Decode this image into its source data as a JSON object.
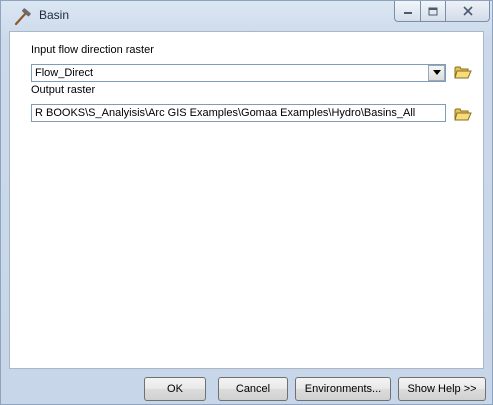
{
  "window": {
    "title": "Basin"
  },
  "form": {
    "input_label": "Input flow direction raster",
    "input_value": "Flow_Direct",
    "output_label": "Output raster",
    "output_value": "R BOOKS\\S_Analyisis\\Arc GIS Examples\\Gomaa Examples\\Hydro\\Basins_All"
  },
  "buttons": {
    "ok": "OK",
    "cancel": "Cancel",
    "environments": "Environments...",
    "show_help": "Show Help >>"
  },
  "icons": {
    "title": "hammer-icon",
    "browse": "open-folder-icon",
    "dropdown": "chevron-down-icon"
  }
}
